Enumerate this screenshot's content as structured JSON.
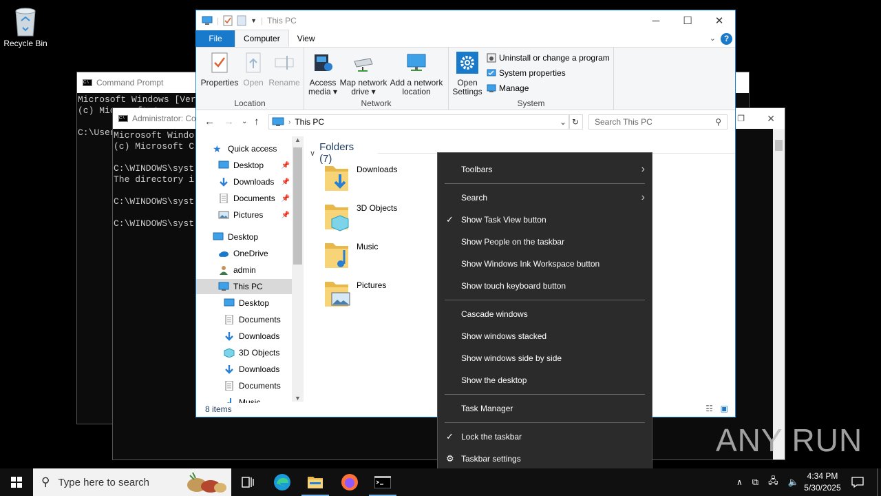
{
  "desktop": {
    "recycle_bin_label": "Recycle Bin"
  },
  "cmd_back": {
    "title": "Command Prompt",
    "lines": "Microsoft Windows [Ver\n(c) Microsoft Co\n\nC:\\User"
  },
  "cmd_front": {
    "title": "Administrator: Co",
    "lines": "Microsoft Windo\n(c) Microsoft C\n\nC:\\WINDOWS\\syst\nThe directory i\n\nC:\\WINDOWS\\syst\n\nC:\\WINDOWS\\syst"
  },
  "explorer": {
    "title": "This PC",
    "window_controls": {
      "minimize": "─",
      "maximize": "☐",
      "close": "✕"
    },
    "tabs": {
      "file": "File",
      "computer": "Computer",
      "view": "View"
    },
    "help": "?",
    "ribbon": {
      "location": {
        "label": "Location",
        "properties": "Properties",
        "open": "Open",
        "rename": "Rename"
      },
      "network": {
        "label": "Network",
        "access_media_1": "Access",
        "access_media_2": "media ▾",
        "map_drive_1": "Map network",
        "map_drive_2": "drive ▾",
        "add_location_1": "Add a network",
        "add_location_2": "location"
      },
      "system": {
        "label": "System",
        "open_settings_1": "Open",
        "open_settings_2": "Settings",
        "uninstall": "Uninstall or change a program",
        "system_properties": "System properties",
        "manage": "Manage"
      }
    },
    "address": {
      "path": "This PC",
      "search_placeholder": "Search This PC"
    },
    "nav": {
      "quick_access": "Quick access",
      "qa_desktop": "Desktop",
      "qa_downloads": "Downloads",
      "qa_documents": "Documents",
      "qa_pictures": "Pictures",
      "desktop": "Desktop",
      "onedrive": "OneDrive",
      "admin": "admin",
      "this_pc": "This PC",
      "pc_desktop": "Desktop",
      "pc_documents": "Documents",
      "pc_downloads": "Downloads",
      "pc_3d": "3D Objects",
      "pc_downloads2": "Downloads",
      "pc_documents2": "Documents",
      "pc_music": "Music"
    },
    "folders_header": "Folders (7)",
    "folders": {
      "downloads": "Downloads",
      "objects3d": "3D Objects",
      "music": "Music",
      "pictures": "Pictures"
    },
    "status": "8 items"
  },
  "context_menu": {
    "toolbars": "Toolbars",
    "search": "Search",
    "task_view": "Show Task View button",
    "people": "Show People on the taskbar",
    "ink": "Show Windows Ink Workspace button",
    "touch_kb": "Show touch keyboard button",
    "cascade": "Cascade windows",
    "stacked": "Show windows stacked",
    "side_by_side": "Show windows side by side",
    "show_desktop": "Show the desktop",
    "task_manager": "Task Manager",
    "lock": "Lock the taskbar",
    "settings": "Taskbar settings",
    "check_mark": "✓",
    "submenu_arrow": "›"
  },
  "watermark": "ANY RUN",
  "taskbar": {
    "search_placeholder": "Type here to search",
    "time": "4:34 PM",
    "date": "5/30/2025"
  },
  "colors": {
    "accent": "#1979ca",
    "menu_bg": "#2b2b2b",
    "taskbar_bg": "#101010"
  }
}
